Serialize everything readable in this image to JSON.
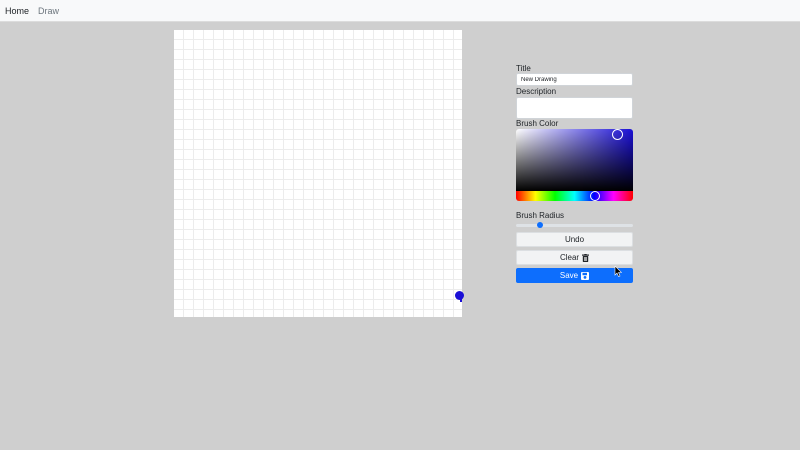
{
  "nav": {
    "home": "Home",
    "draw": "Draw"
  },
  "form": {
    "title_label": "Title",
    "title_value": "New Drawing",
    "description_label": "Description",
    "description_value": "",
    "brush_color_label": "Brush Color",
    "brush_color": "#1a0fd6",
    "brush_radius_label": "Brush Radius",
    "brush_radius_fraction": 0.2
  },
  "buttons": {
    "undo": "Undo",
    "clear": "Clear",
    "save": "Save"
  },
  "icons": {
    "clear": "trash-icon",
    "save": "floppy-disk-icon"
  },
  "colors": {
    "primary": "#0d6efd",
    "brush": "#1a0fd6"
  }
}
